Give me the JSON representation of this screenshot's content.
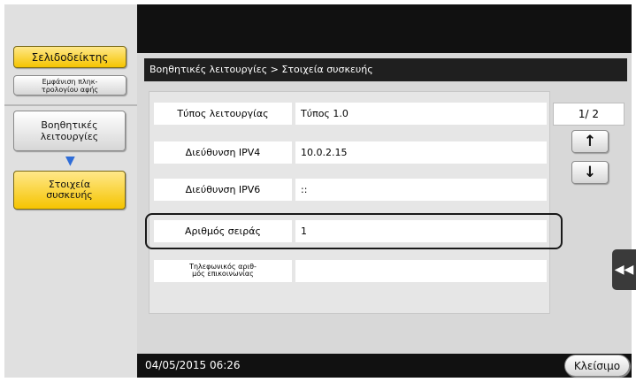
{
  "sidebar": {
    "bookmark": "Σελιδοδείκτης",
    "keypad": [
      "Εμφάνιση πληκ-",
      "τρολογίου αφής"
    ],
    "utility": [
      "Βοηθητικές",
      "λειτουργίες"
    ],
    "device_info": [
      "Στοιχεία",
      "συσκευής"
    ]
  },
  "breadcrumb": "Βοηθητικές λειτουργίες > Στοιχεία συσκευής",
  "rows": [
    {
      "label": "Τύπος λειτουργίας",
      "value": "Τύπος 1.0"
    },
    {
      "label": "Διεύθυνση IPV4",
      "value": "10.0.2.15"
    },
    {
      "label": "Διεύθυνση IPV6",
      "value": "::"
    },
    {
      "label": "Αριθμός σειράς",
      "value": "1"
    },
    {
      "label": [
        "Τηλεφωνικός αριθ-",
        "μός επικοινωνίας"
      ],
      "value": ""
    }
  ],
  "pager": {
    "indicator": "1/ 2",
    "up_icon": "↑",
    "down_icon": "↓"
  },
  "side_tab_icon": "◀◀",
  "footer": {
    "datetime": "04/05/2015  06:26",
    "close": "Κλείσιμο"
  },
  "colors": {
    "highlight": "#f5c400",
    "arrow": "#2f6dd8",
    "topbar": "#111111"
  }
}
